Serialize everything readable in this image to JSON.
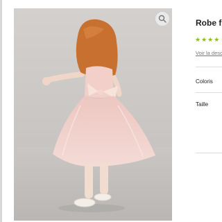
{
  "product": {
    "title": "Robe f",
    "rating_stars": "★★★★",
    "description_link": "Voir la desc"
  },
  "options": {
    "color_label": "Coloris",
    "size_label": "Taille"
  },
  "image": {
    "alt": "Fillette rousse en robe de tulle rose avec nœud, vue de dos",
    "zoom_icon": "magnifier-icon"
  },
  "colors": {
    "rating": "#8bbb22",
    "dress": "#f2cfc9",
    "hair": "#c8702f"
  }
}
